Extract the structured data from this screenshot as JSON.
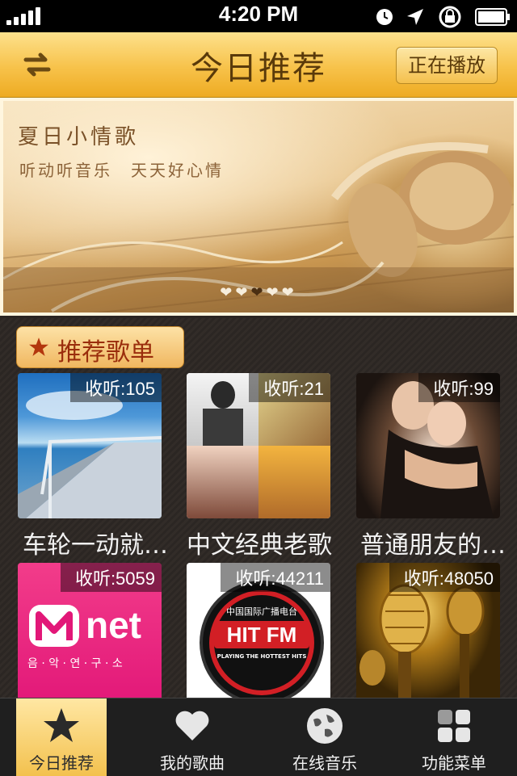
{
  "status_bar": {
    "time": "4:20 PM"
  },
  "header": {
    "title": "今日推荐",
    "now_playing_label": "正在播放"
  },
  "banner": {
    "title": "夏日小情歌",
    "subtitle": "听动听音乐　天天好心情",
    "page_count": 5,
    "active_page": 3
  },
  "section": {
    "title": "推荐歌单"
  },
  "playlists": [
    {
      "name": "车轮一动就…",
      "listens": "收听:105"
    },
    {
      "name": "中文经典老歌",
      "listens": "收听:21"
    },
    {
      "name": "普通朋友的…",
      "listens": "收听:99"
    },
    {
      "name": "",
      "listens": "收听:5059",
      "cover_text": "net",
      "cover_sub": "음 · 악 · 연 · 구 · 소"
    },
    {
      "name": "",
      "listens": "收听:44211",
      "cover_text": "HIT FM",
      "cover_top": "中国国际广播电台",
      "cover_sub": "PLAYING THE HOTTEST HITS"
    },
    {
      "name": "",
      "listens": "收听:48050"
    }
  ],
  "tabs": [
    {
      "label": "今日推荐",
      "icon": "star-icon",
      "active": true
    },
    {
      "label": "我的歌曲",
      "icon": "heart-icon",
      "active": false
    },
    {
      "label": "在线音乐",
      "icon": "globe-icon",
      "active": false
    },
    {
      "label": "功能菜单",
      "icon": "grid-icon",
      "active": false
    }
  ],
  "colors": {
    "header_gold": "#f7c24a",
    "title_brown": "#5a3a0a",
    "tag_red": "#9a2d0c"
  }
}
